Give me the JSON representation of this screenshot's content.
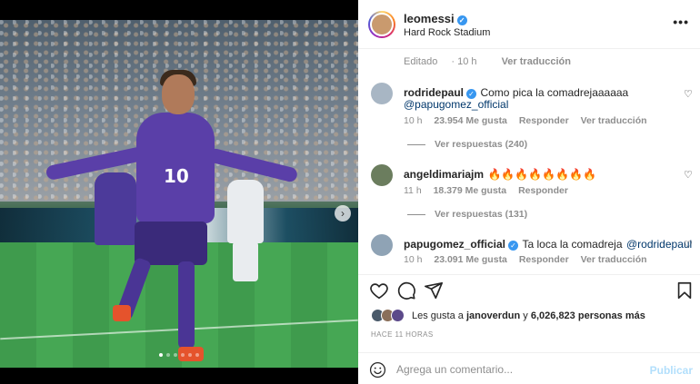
{
  "post": {
    "author": "leomessi",
    "location": "Hard Rock Stadium",
    "more_icon": "more-horizontal-icon",
    "media": {
      "jersey_number": "10",
      "carousel_count": 6,
      "carousel_active": 1
    }
  },
  "previous_comment": {
    "edited": "Editado",
    "time": "10 h",
    "translate": "Ver traducción"
  },
  "comments": [
    {
      "user": "rodridepaul",
      "verified": true,
      "text": "Como pica la comadrejaaaaaa",
      "mention": "@papugomez_official",
      "time": "10 h",
      "likes": "23.954 Me gusta",
      "reply": "Responder",
      "translate": "Ver traducción",
      "replies": "Ver respuestas (240)"
    },
    {
      "user": "angeldimariajm",
      "verified": false,
      "text": "🔥🔥🔥🔥🔥🔥🔥🔥",
      "time": "11 h",
      "likes": "18.379 Me gusta",
      "reply": "Responder",
      "replies": "Ver respuestas (131)"
    },
    {
      "user": "papugomez_official",
      "verified": true,
      "text": "Ta loca la comadreja",
      "mention": "@rodridepaul",
      "time": "10 h",
      "likes": "23.091 Me gusta",
      "reply": "Responder",
      "translate": "Ver traducción"
    }
  ],
  "likes": {
    "prefix": "Les gusta a",
    "user": "janoverdun",
    "connector": "y",
    "others": "6,026,823 personas más"
  },
  "timestamp": "HACE 11 HORAS",
  "composer": {
    "placeholder": "Agrega un comentario...",
    "publish": "Publicar"
  },
  "colors": {
    "verified": "#3897f0",
    "mention": "#00376b",
    "publish_disabled": "#b2dffc",
    "jersey": "#5a3fa8"
  }
}
